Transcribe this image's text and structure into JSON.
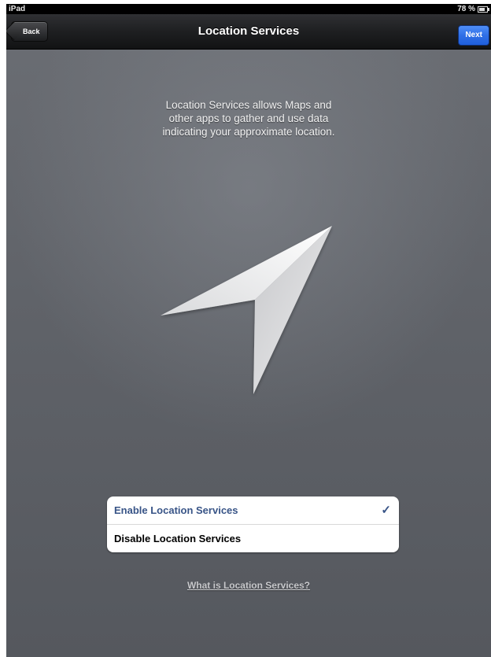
{
  "status_bar": {
    "device_name": "iPad",
    "battery_level": "78 %",
    "battery_icon": "battery-icon"
  },
  "nav": {
    "title": "Location Services",
    "back_label": "Back",
    "next_label": "Next",
    "next_color": "#2f6fe6"
  },
  "description_lines": [
    "Location Services allows Maps and",
    "other apps to gather and use data",
    "indicating your approximate location."
  ],
  "hero_icon": "location-arrow-icon",
  "options": [
    {
      "label": "Enable Location Services",
      "selected": true
    },
    {
      "label": "Disable Location Services",
      "selected": false
    }
  ],
  "selected_check": "✓",
  "selected_color": "#385487",
  "help_link": "What is Location Services?"
}
